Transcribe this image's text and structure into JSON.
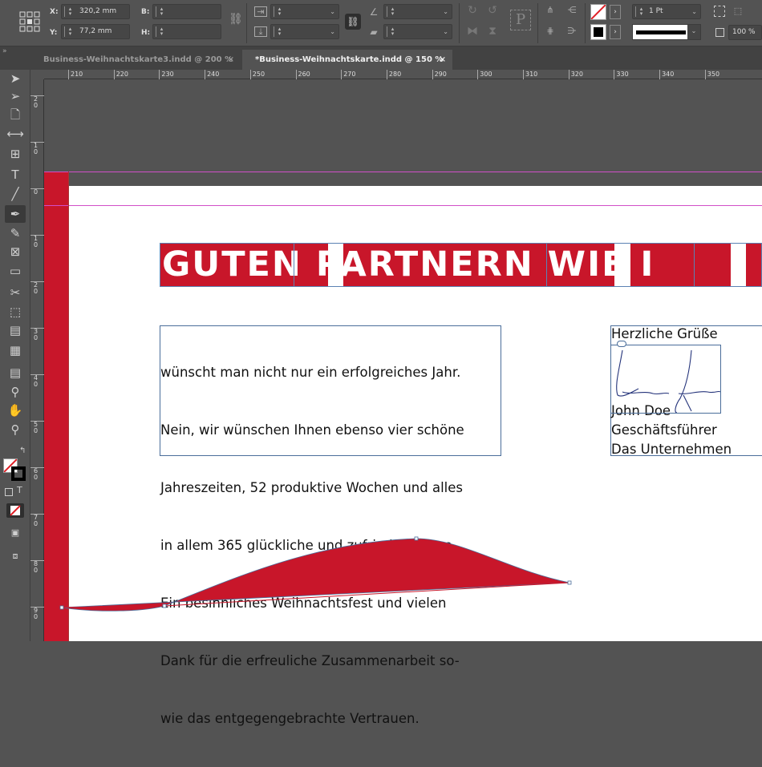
{
  "control_panel": {
    "x_label": "X:",
    "x_value": "320,2 mm",
    "y_label": "Y:",
    "y_value": "77,2 mm",
    "w_label": "B:",
    "h_label": "H:",
    "stroke_weight": "1 Pt",
    "opacity": "100 %"
  },
  "tabs": [
    {
      "label": "Business-Weihnachtskarte3.indd @ 200 %",
      "close": "×"
    },
    {
      "label": "*Business-Weihnachtskarte.indd @ 150 %",
      "close": "×"
    }
  ],
  "ruler": {
    "h": [
      "210",
      "220",
      "230",
      "240",
      "250",
      "260",
      "270",
      "280",
      "290",
      "300",
      "310",
      "320",
      "330",
      "340",
      "350"
    ],
    "v": [
      "2\n0",
      "1\n0",
      "0",
      "1\n0",
      "2\n0",
      "3\n0",
      "4\n0",
      "5\n0",
      "6\n0",
      "7\n0",
      "8\n0",
      "9\n0"
    ]
  },
  "document": {
    "headline": "GUTEN PARTNERN WIE I",
    "body_lines": [
      "wünscht man nicht nur ein erfolgreiches Jahr.",
      "Nein, wir wünschen Ihnen ebenso vier schöne",
      "Jahreszeiten, 52 produktive Wochen und alles",
      "in allem 365 glückliche und zufriedene Tage.",
      "Ein besinnliches Weihnachtsfest und vielen",
      "Dank für die erfreuliche Zusammenarbeit so-",
      "wie das entgegengebrachte Vertrauen."
    ],
    "greeting": "Herzliche Grüße",
    "signature_lines": [
      "John Doe",
      "Geschäftsführer",
      "Das Unternehmen"
    ]
  },
  "colors": {
    "brand_red": "#c8162a",
    "frame_blue": "#4a6d9a",
    "guide_magenta": "#d24fc8"
  }
}
